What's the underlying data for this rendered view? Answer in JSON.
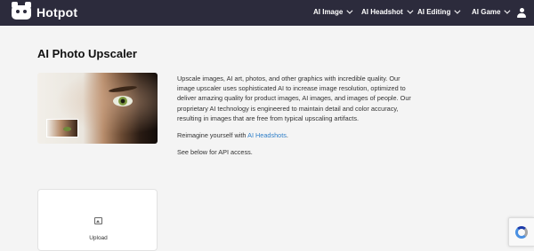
{
  "nav": {
    "logo_text": "Hotpot",
    "items": [
      {
        "label": "AI Image"
      },
      {
        "label": "AI Headshot"
      },
      {
        "label": "AI Editing"
      },
      {
        "label": "AI Game"
      }
    ],
    "user_icon": "user-icon",
    "bg_color": "#2c2b3c"
  },
  "page": {
    "title": "AI Photo Upscaler",
    "description": "Upscale images, AI art, photos, and other graphics with incredible quality. Our image upscaler uses sophisticated AI to increase image resolution, optimized to deliver amazing quality for product images, AI images, and images of people. Our proprietary AI technology is engineered to maintain detail and color accuracy, resulting in images that are free from typical upscaling artifacts.",
    "reimagine_text": "Reimagine yourself with ",
    "reimagine_link": "AI Headshots",
    "reimagine_suffix": ".",
    "api_text": "See below for API access.",
    "link_color": "#2f7fc8"
  },
  "upload": {
    "icon": "image-icon",
    "label": "Upload"
  },
  "captcha": {
    "icon": "recaptcha-icon"
  }
}
